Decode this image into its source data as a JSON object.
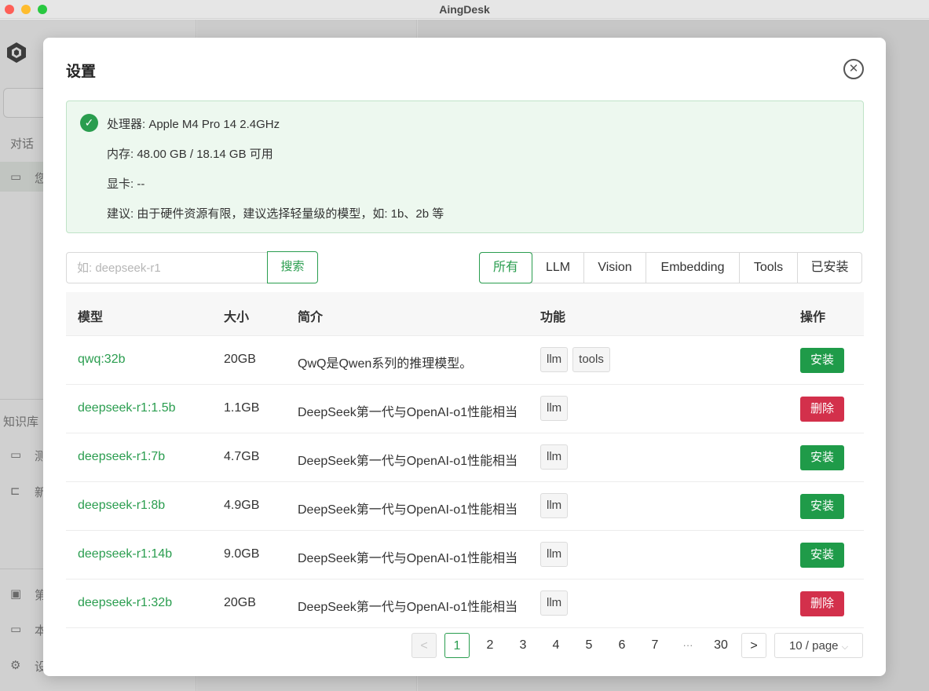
{
  "window": {
    "title": "AingDesk"
  },
  "sidebar": {
    "sections": [
      {
        "label": "对话"
      },
      {
        "label": "知识库"
      }
    ],
    "chat_item_char": "您",
    "kb_items": [
      "测",
      "新"
    ],
    "bottom_items": [
      "第",
      "本",
      "设"
    ]
  },
  "dialog": {
    "title": "设置",
    "hardware": {
      "cpu": "处理器: Apple M4 Pro 14 2.4GHz",
      "memory": "内存: 48.00 GB / 18.14 GB 可用",
      "gpu": "显卡: --",
      "suggestion": "建议: 由于硬件资源有限，建议选择轻量级的模型，如: 1b、2b 等"
    },
    "search": {
      "placeholder": "如: deepseek-r1",
      "value": "",
      "button": "搜索"
    },
    "filters": [
      "所有",
      "LLM",
      "Vision",
      "Embedding",
      "Tools",
      "已安装"
    ],
    "active_filter": "所有",
    "table": {
      "headers": [
        "模型",
        "大小",
        "简介",
        "功能",
        "操作"
      ],
      "rows": [
        {
          "name": "qwq:32b",
          "size": "20GB",
          "desc": "QwQ是Qwen系列的推理模型。",
          "tags": [
            "llm",
            "tools"
          ],
          "action": "安装"
        },
        {
          "name": "deepseek-r1:1.5b",
          "size": "1.1GB",
          "desc": "DeepSeek第一代与OpenAI-o1性能相当",
          "tags": [
            "llm"
          ],
          "action": "删除"
        },
        {
          "name": "deepseek-r1:7b",
          "size": "4.7GB",
          "desc": "DeepSeek第一代与OpenAI-o1性能相当",
          "tags": [
            "llm"
          ],
          "action": "安装"
        },
        {
          "name": "deepseek-r1:8b",
          "size": "4.9GB",
          "desc": "DeepSeek第一代与OpenAI-o1性能相当",
          "tags": [
            "llm"
          ],
          "action": "安装"
        },
        {
          "name": "deepseek-r1:14b",
          "size": "9.0GB",
          "desc": "DeepSeek第一代与OpenAI-o1性能相当",
          "tags": [
            "llm"
          ],
          "action": "安装"
        },
        {
          "name": "deepseek-r1:32b",
          "size": "20GB",
          "desc": "DeepSeek第一代与OpenAI-o1性能相当",
          "tags": [
            "llm"
          ],
          "action": "删除"
        }
      ]
    },
    "pagination": {
      "prev": "<",
      "pages": [
        "1",
        "2",
        "3",
        "4",
        "5",
        "6",
        "7"
      ],
      "ellipsis": "···",
      "last": "30",
      "next": ">",
      "current": "1",
      "page_size": "10 / page"
    }
  },
  "colors": {
    "accent": "#2a9d4f",
    "install": "#1f9b49",
    "delete": "#d3304b",
    "info_bg": "#edf8ef"
  }
}
